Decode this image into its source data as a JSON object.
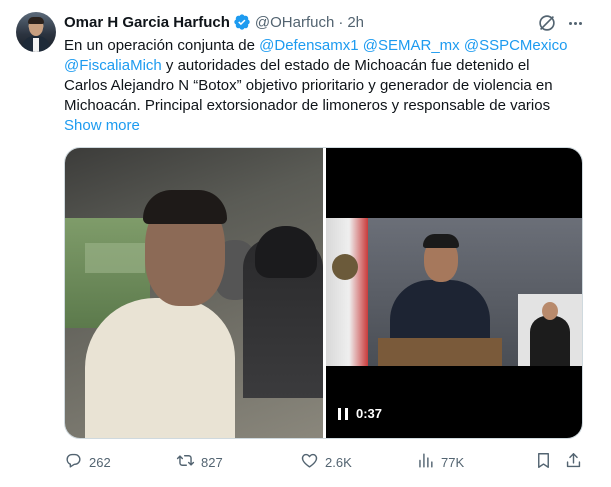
{
  "author": {
    "name": "Omar H Garcia Harfuch",
    "handle": "@OHarfuch",
    "separator": "·",
    "time": "2h",
    "verified": true
  },
  "icons": {
    "verified": "verified-badge-icon",
    "grok": "grok-icon",
    "more": "more-options-icon",
    "reply": "reply-icon",
    "retweet": "retweet-icon",
    "like": "heart-icon",
    "views": "views-chart-icon",
    "bookmark": "bookmark-icon",
    "share": "share-icon",
    "pause": "pause-icon"
  },
  "tweet": {
    "line1_prefix": "En un operación conjunta de ",
    "mention1": "@Defensamx1",
    "mention2": "@SEMAR_mx",
    "mention3": "@SSPCMexico",
    "mention4": "@FiscaliaMich",
    "line2_suffix": " y autoridades del estado de Michoacán fue detenido el",
    "line3": "Carlos Alejandro N “Botox” objetivo prioritario y generador de violencia en",
    "line4": "Michoacán. Principal extorsionador de limoneros y responsable de varios",
    "show_more": "Show more"
  },
  "media": {
    "video_time": "0:37"
  },
  "actions": {
    "replies": "262",
    "retweets": "827",
    "likes": "2.6K",
    "views": "77K"
  },
  "colors": {
    "accent": "#1d9bf0",
    "text": "#0f1419",
    "muted": "#536471",
    "border": "#cfd9de"
  }
}
